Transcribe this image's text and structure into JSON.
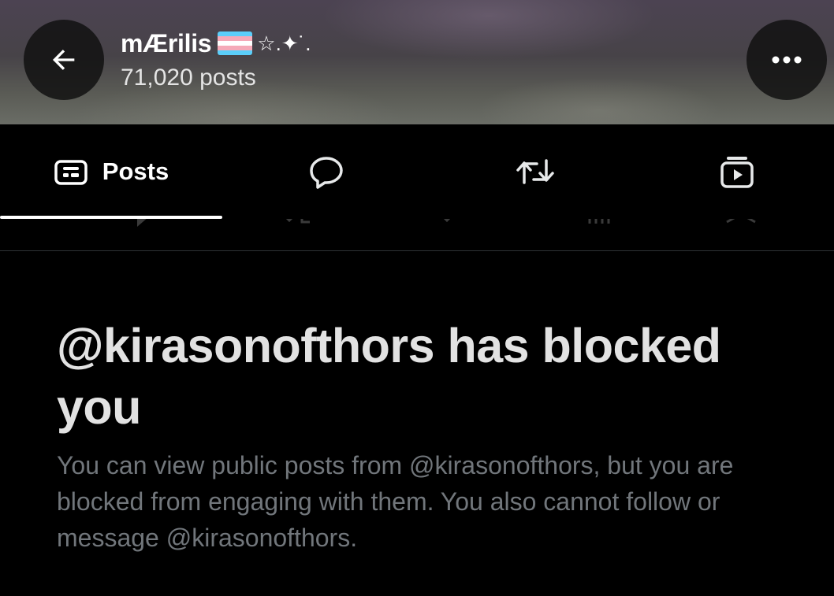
{
  "header": {
    "display_name": "mÆrilis",
    "name_decoration": "☆.✦˙.",
    "post_count": "71,020 posts",
    "back_icon": "arrow-left-icon",
    "more_icon": "more-horizontal-icon"
  },
  "tabs": [
    {
      "label": "Posts",
      "icon": "posts-icon",
      "active": true
    },
    {
      "label": "",
      "icon": "replies-icon",
      "active": false
    },
    {
      "label": "",
      "icon": "reposts-icon",
      "active": false
    },
    {
      "label": "",
      "icon": "media-icon",
      "active": false
    }
  ],
  "blocked": {
    "title": "@kirasonofthors has blocked you",
    "body": "You can view public posts from @kirasonofthors, but you are blocked from engaging with them. You also cannot follow or message @kirasonofthors."
  },
  "colors": {
    "background": "#000000",
    "primary_text": "#e7e9ea",
    "secondary_text": "#71767b",
    "divider": "#2f3336",
    "flag_blue": "#5bcefa",
    "flag_pink": "#f5a9b8",
    "flag_white": "#ffffff"
  }
}
